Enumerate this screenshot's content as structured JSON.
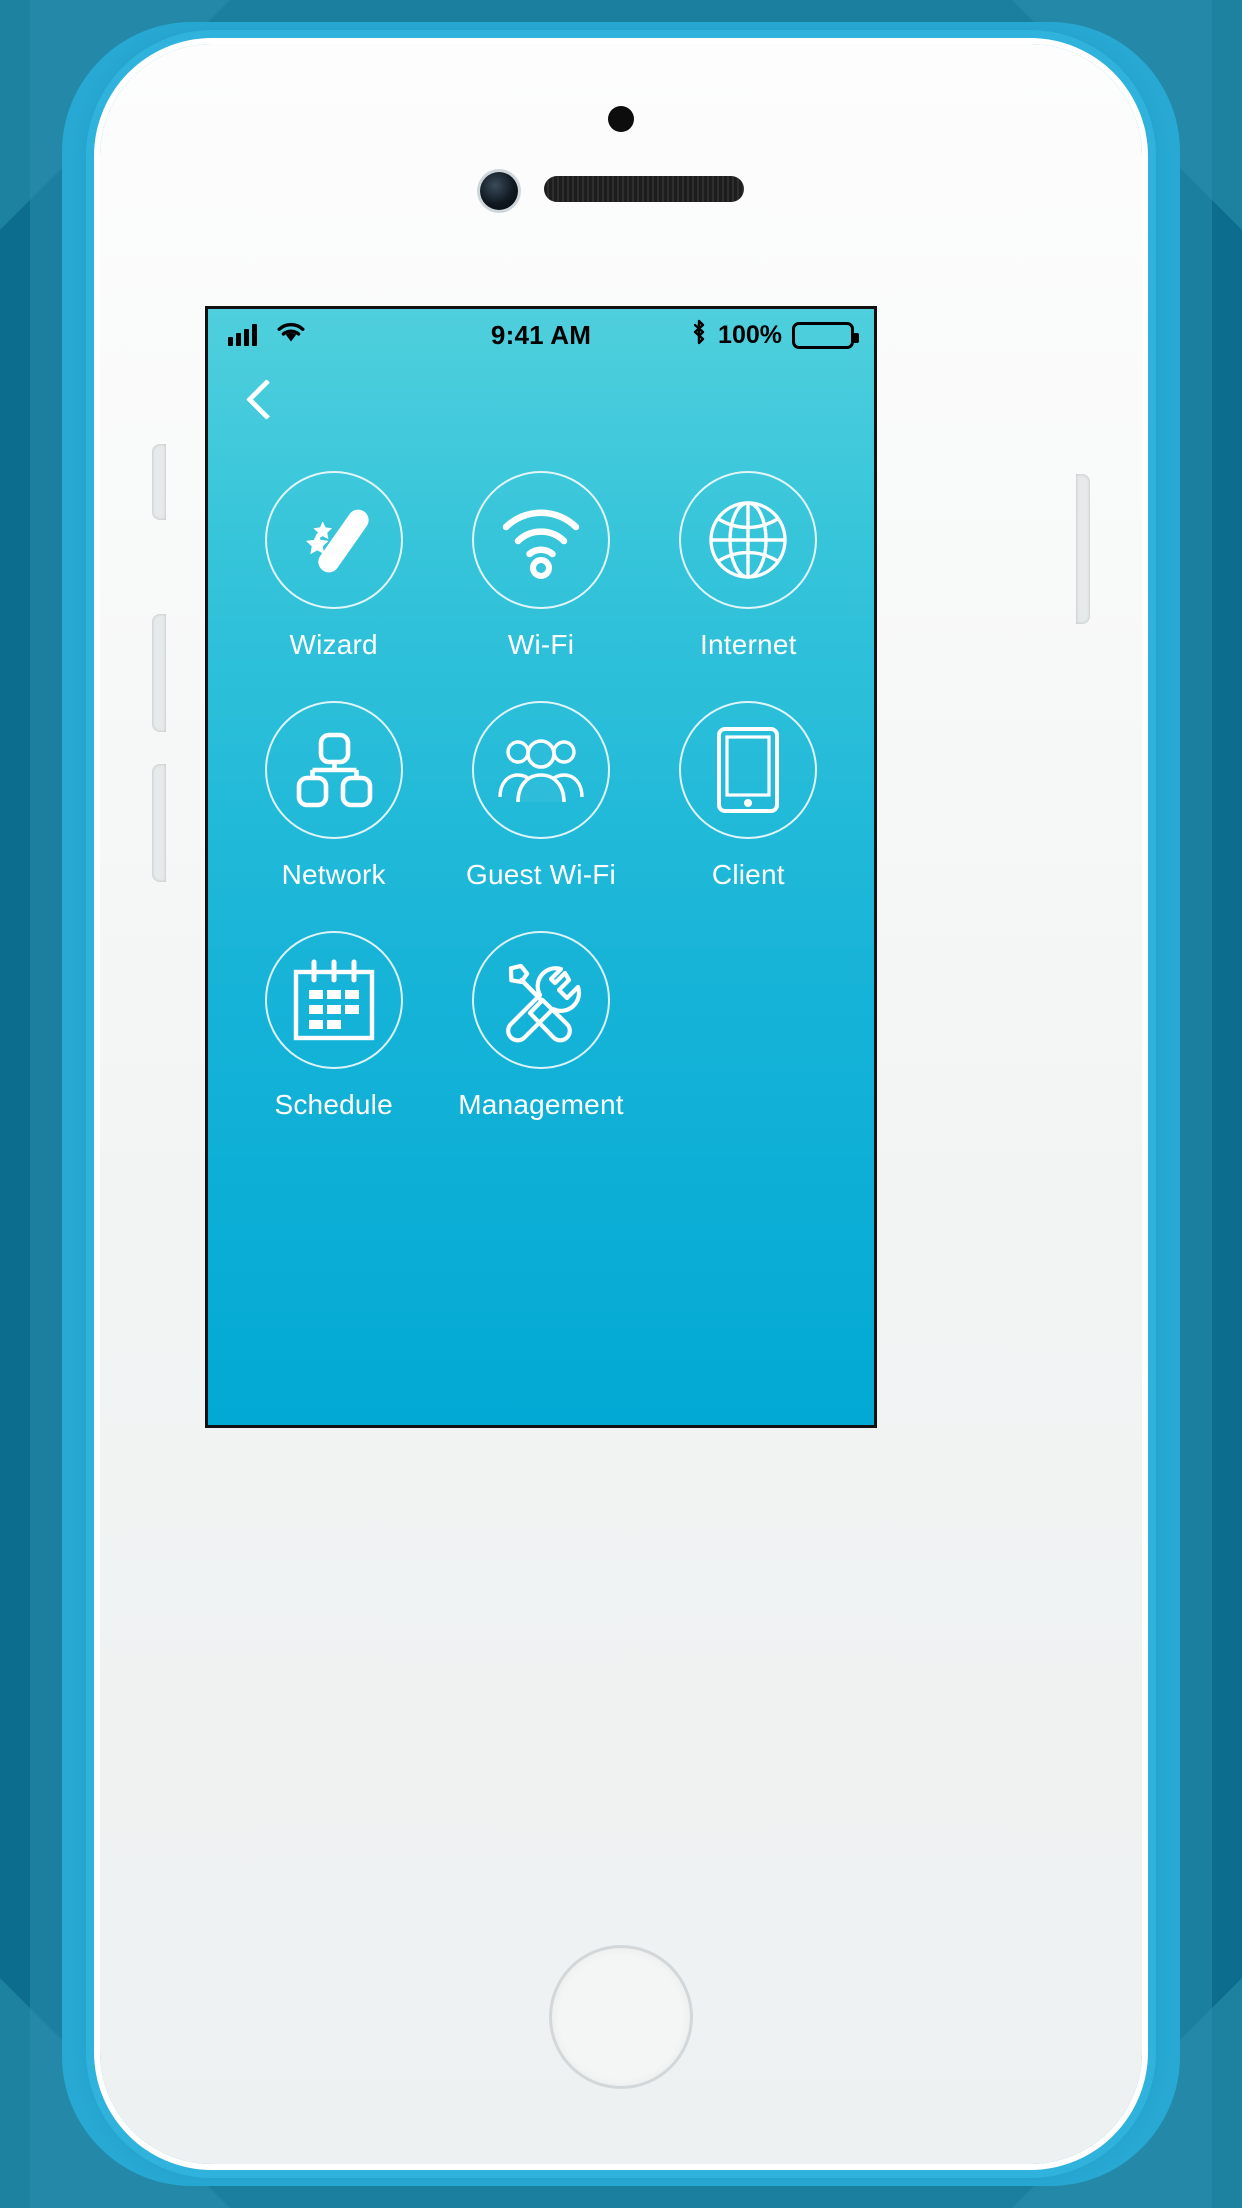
{
  "statusbar": {
    "signal_icon": "cellular-bars-icon",
    "wifi_icon": "wifi-icon",
    "time": "9:41 AM",
    "bluetooth_icon": "bluetooth-icon",
    "battery_percent": "100%",
    "battery_icon": "battery-full-icon"
  },
  "navbar": {
    "back_icon": "chevron-left-icon"
  },
  "colors": {
    "screen_gradient_top": "#4fcfdd",
    "screen_gradient_bottom": "#02a9d4",
    "device_frame": "#27a9d4",
    "backdrop": "#1b7fa0",
    "icon_stroke": "#ffffff"
  },
  "menu": {
    "items": [
      {
        "label": "Wizard",
        "icon": "magic-wand-icon"
      },
      {
        "label": "Wi-Fi",
        "icon": "wifi-signal-icon"
      },
      {
        "label": "Internet",
        "icon": "globe-icon"
      },
      {
        "label": "Network",
        "icon": "network-hierarchy-icon"
      },
      {
        "label": "Guest Wi-Fi",
        "icon": "people-group-icon"
      },
      {
        "label": "Client",
        "icon": "tablet-device-icon"
      },
      {
        "label": "Schedule",
        "icon": "calendar-icon"
      },
      {
        "label": "Management",
        "icon": "tools-wrench-screwdriver-icon"
      }
    ]
  }
}
